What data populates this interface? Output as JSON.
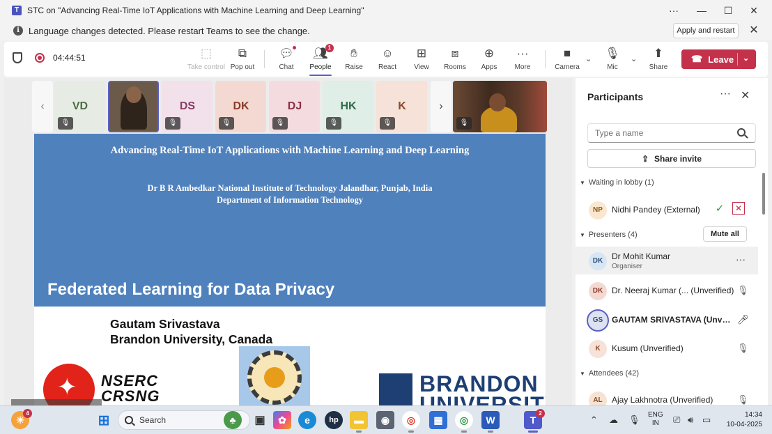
{
  "window": {
    "title": "STC on \"Advancing Real-Time IoT Applications with Machine Learning and Deep Learning\"",
    "controls": {
      "more": "···",
      "minimize": "—",
      "maximize": "☐",
      "close": "✕"
    }
  },
  "notification": {
    "message": "Language changes detected. Please restart Teams to see the change.",
    "button": "Apply and restart"
  },
  "toolbar": {
    "timer": "04:44:51",
    "buttons": {
      "take_control": "Take control",
      "pop_out": "Pop out",
      "chat": "Chat",
      "people": "People",
      "people_badge": "1",
      "raise": "Raise",
      "react": "React",
      "view": "View",
      "rooms": "Rooms",
      "apps": "Apps",
      "more": "More",
      "camera": "Camera",
      "mic": "Mic",
      "share": "Share"
    },
    "leave": "Leave"
  },
  "gallery": {
    "tiles": [
      {
        "initials": "VD",
        "bg": "#e6ece4",
        "fg": "#4d6b45"
      },
      {
        "initials": "DS",
        "bg": "#f2e0ea",
        "fg": "#8a3d66"
      },
      {
        "initials": "DK",
        "bg": "#f4d9d2",
        "fg": "#8a3a2a"
      },
      {
        "initials": "DJ",
        "bg": "#f4dbe0",
        "fg": "#8a2f44"
      },
      {
        "initials": "HK",
        "bg": "#dfeee6",
        "fg": "#2f6b4a"
      },
      {
        "initials": "K",
        "bg": "#f6e2d8",
        "fg": "#8a4a2a"
      }
    ]
  },
  "slide": {
    "title": "Advancing Real-Time IoT Applications with Machine Learning and Deep Learning",
    "institute": "Dr B R Ambedkar National Institute of Technology Jalandhar, Punjab, India",
    "department": "Department of Information Technology",
    "topic": "Federated Learning for Data Privacy",
    "speaker_name": "Gautam Srivastava",
    "speaker_affiliation": "Brandon University, Canada",
    "logo_nserc_1": "NSERC",
    "logo_nserc_2": "CRSNG",
    "logo_brandon_1": "BRANDON",
    "logo_brandon_2": "UNIVERSITY"
  },
  "participants": {
    "title": "Participants",
    "search_placeholder": "Type a name",
    "share_invite": "Share invite",
    "lobby_header": "Waiting in lobby (1)",
    "lobby": [
      {
        "initials": "NP",
        "name": "Nidhi Pandey (External)",
        "bg": "#fbe6cf",
        "fg": "#8a5a1a"
      }
    ],
    "presenters_header": "Presenters (4)",
    "mute_all": "Mute all",
    "presenters": [
      {
        "initials": "DK",
        "name": "Dr Mohit Kumar",
        "role": "Organiser",
        "bg": "#d8e6f4",
        "fg": "#2a4f7a"
      },
      {
        "initials": "DK",
        "name": "Dr. Neeraj Kumar (... (Unverified)",
        "bg": "#f4d9d2",
        "fg": "#8a3a2a"
      },
      {
        "initials": "GS",
        "name": "GAUTAM SRIVASTAVA (Unverified)",
        "bg": "#dce2f0",
        "fg": "#3a4a7a"
      },
      {
        "initials": "K",
        "name": "Kusum (Unverified)",
        "bg": "#f6e2d8",
        "fg": "#8a4a2a"
      }
    ],
    "attendees_header": "Attendees (42)",
    "attendees": [
      {
        "initials": "AL",
        "name": "Ajay Lakhnotra (Unverified)",
        "bg": "#f7e3d3",
        "fg": "#8a4a2a"
      }
    ]
  },
  "taskbar": {
    "widgets_badge": "4",
    "search": "Search",
    "teams_badge": "2",
    "lang_1": "ENG",
    "lang_2": "IN",
    "time": "14:34",
    "date": "10-04-2025"
  },
  "colors": {
    "accent": "#5b5fc7",
    "leave": "#c4314b",
    "slide_blue": "#4f81bd"
  }
}
